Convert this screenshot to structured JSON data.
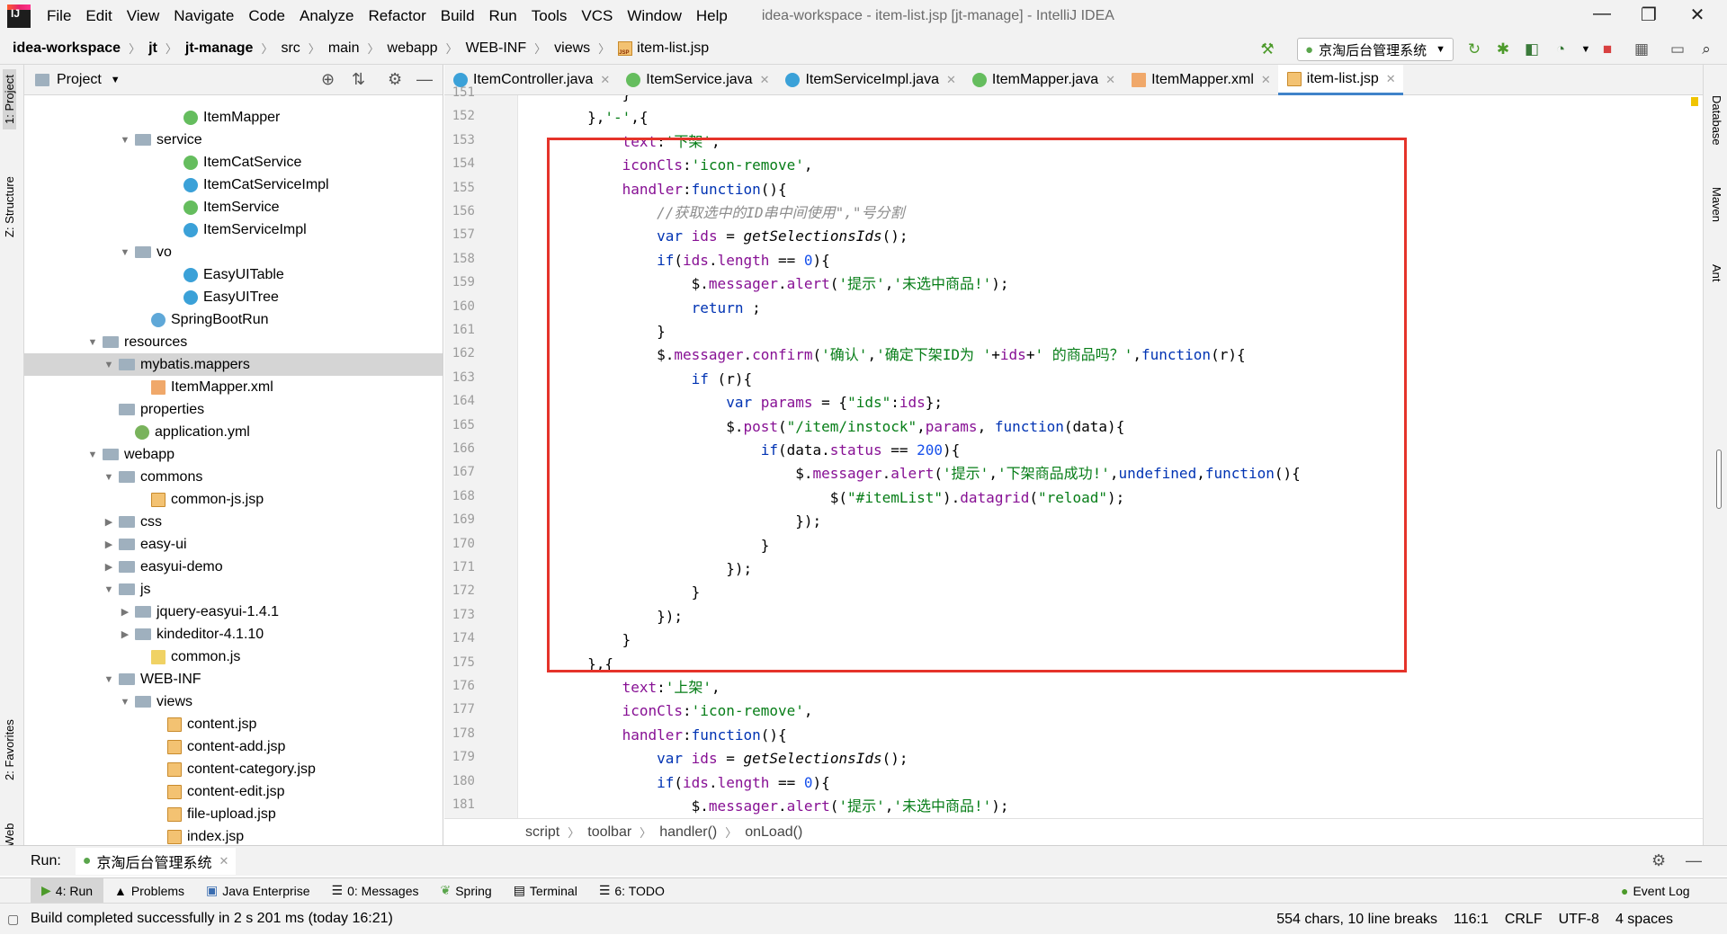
{
  "menubar": {
    "items": [
      "File",
      "Edit",
      "View",
      "Navigate",
      "Code",
      "Analyze",
      "Refactor",
      "Build",
      "Run",
      "Tools",
      "VCS",
      "Window",
      "Help"
    ],
    "window_title": "idea-workspace - item-list.jsp [jt-manage] - IntelliJ IDEA"
  },
  "navbar": {
    "crumbs": [
      "idea-workspace",
      "jt",
      "jt-manage",
      "src",
      "main",
      "webapp",
      "WEB-INF",
      "views",
      "item-list.jsp"
    ],
    "run_config": "京淘后台管理系统"
  },
  "left_stripe": {
    "project": "1: Project",
    "structure": "Z: Structure",
    "favorites": "2: Favorites",
    "web": "Web"
  },
  "right_stripe": {
    "database": "Database",
    "maven": "Maven",
    "ant": "Ant"
  },
  "project_panel": {
    "title": "Project",
    "tree": [
      {
        "label": "ItemMapper",
        "icon": "interface-icon",
        "arrow": ""
      },
      {
        "label": "service",
        "icon": "folder-icon",
        "arrow": "▼"
      },
      {
        "label": "ItemCatService",
        "icon": "interface-icon",
        "arrow": ""
      },
      {
        "label": "ItemCatServiceImpl",
        "icon": "class-icon",
        "arrow": ""
      },
      {
        "label": "ItemService",
        "icon": "interface-icon",
        "arrow": ""
      },
      {
        "label": "ItemServiceImpl",
        "icon": "class-icon",
        "arrow": ""
      },
      {
        "label": "vo",
        "icon": "folder-icon",
        "arrow": "▼"
      },
      {
        "label": "EasyUITable",
        "icon": "class-icon",
        "arrow": ""
      },
      {
        "label": "EasyUITree",
        "icon": "class-icon",
        "arrow": ""
      },
      {
        "label": "SpringBootRun",
        "icon": "boot-icon",
        "arrow": ""
      },
      {
        "label": "resources",
        "icon": "folder-icon",
        "arrow": "▼"
      },
      {
        "label": "mybatis.mappers",
        "icon": "folder-icon",
        "arrow": "▼"
      },
      {
        "label": "ItemMapper.xml",
        "icon": "xml-icon",
        "arrow": ""
      },
      {
        "label": "properties",
        "icon": "folder-icon",
        "arrow": ""
      },
      {
        "label": "application.yml",
        "icon": "yml-icon",
        "arrow": ""
      },
      {
        "label": "webapp",
        "icon": "folder-icon",
        "arrow": "▼"
      },
      {
        "label": "commons",
        "icon": "folder-icon",
        "arrow": "▼"
      },
      {
        "label": "common-js.jsp",
        "icon": "jsp-icon",
        "arrow": ""
      },
      {
        "label": "css",
        "icon": "folder-icon",
        "arrow": "▶"
      },
      {
        "label": "easy-ui",
        "icon": "folder-icon",
        "arrow": "▶"
      },
      {
        "label": "easyui-demo",
        "icon": "folder-icon",
        "arrow": "▶"
      },
      {
        "label": "js",
        "icon": "folder-icon",
        "arrow": "▼"
      },
      {
        "label": "jquery-easyui-1.4.1",
        "icon": "folder-icon",
        "arrow": "▶"
      },
      {
        "label": "kindeditor-4.1.10",
        "icon": "folder-icon",
        "arrow": "▶"
      },
      {
        "label": "common.js",
        "icon": "js-icon",
        "arrow": ""
      },
      {
        "label": "WEB-INF",
        "icon": "folder-icon",
        "arrow": "▼"
      },
      {
        "label": "views",
        "icon": "folder-icon",
        "arrow": "▼"
      },
      {
        "label": "content.jsp",
        "icon": "jsp-icon",
        "arrow": ""
      },
      {
        "label": "content-add.jsp",
        "icon": "jsp-icon",
        "arrow": ""
      },
      {
        "label": "content-category.jsp",
        "icon": "jsp-icon",
        "arrow": ""
      },
      {
        "label": "content-edit.jsp",
        "icon": "jsp-icon",
        "arrow": ""
      },
      {
        "label": "file-upload.jsp",
        "icon": "jsp-icon",
        "arrow": ""
      },
      {
        "label": "index.jsp",
        "icon": "jsp-icon",
        "arrow": ""
      }
    ]
  },
  "editor_tabs": [
    "ItemController.java",
    "ItemService.java",
    "ItemServiceImpl.java",
    "ItemMapper.java",
    "ItemMapper.xml",
    "item-list.jsp"
  ],
  "line_numbers": [
    "151",
    "152",
    "153",
    "154",
    "155",
    "156",
    "157",
    "158",
    "159",
    "160",
    "161",
    "162",
    "163",
    "164",
    "165",
    "166",
    "167",
    "168",
    "169",
    "170",
    "171",
    "172",
    "173",
    "174",
    "175",
    "176",
    "177",
    "178",
    "179",
    "180",
    "181"
  ],
  "code_lines": [
    "            }",
    "        },'-',{",
    "            text:'下架',",
    "            iconCls:'icon-remove',",
    "            handler:function(){",
    "                //获取选中的ID串中间使用\",\"号分割",
    "                var ids = getSelectionsIds();",
    "                if(ids.length == 0){",
    "                    $.messager.alert('提示','未选中商品!');",
    "                    return ;",
    "                }",
    "                $.messager.confirm('确认','确定下架ID为 '+ids+' 的商品吗？',function(r){",
    "                    if (r){",
    "                        var params = {\"ids\":ids};",
    "                        $.post(\"/item/instock\",params, function(data){",
    "                            if(data.status == 200){",
    "                                $.messager.alert('提示','下架商品成功!',undefined,function(){",
    "                                    $(\"#itemList\").datagrid(\"reload\");",
    "                                });",
    "                            }",
    "                        });",
    "                    }",
    "                });",
    "            }",
    "        },{",
    "            text:'上架',",
    "            iconCls:'icon-remove',",
    "            handler:function(){",
    "                var ids = getSelectionsIds();",
    "                if(ids.length == 0){",
    "                    $.messager.alert('提示','未选中商品!');"
  ],
  "code_crumbs": [
    "script",
    "toolbar",
    "handler()",
    "onLoad()"
  ],
  "run_bar": {
    "label": "Run:",
    "config": "京淘后台管理系统"
  },
  "bottom_tabs": [
    "4: Run",
    "Problems",
    "Java Enterprise",
    "0: Messages",
    "Spring",
    "Terminal",
    "6: TODO"
  ],
  "event_log": "Event Log",
  "status": {
    "message": "Build completed successfully in 2 s 201 ms (today 16:21)",
    "chars": "554 chars, 10 line breaks",
    "position": "116:1",
    "line_sep": "CRLF",
    "encoding": "UTF-8",
    "indent": "4 spaces"
  },
  "colors": {
    "highlight_box": "#e5332a",
    "keyword": "#0033b3",
    "string": "#067d17",
    "property": "#871094"
  }
}
